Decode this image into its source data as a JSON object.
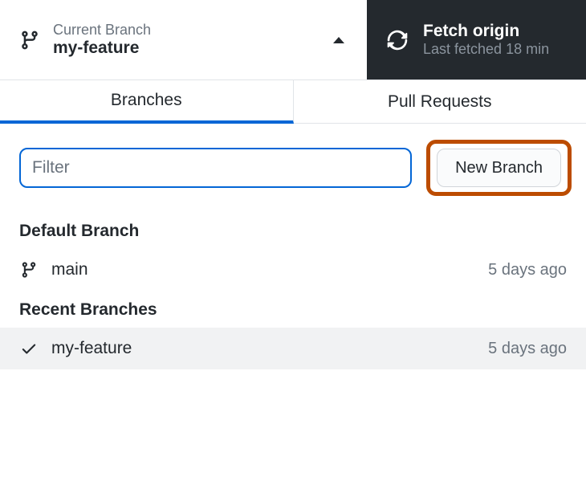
{
  "toolbar": {
    "branchLabel": "Current Branch",
    "branchValue": "my-feature",
    "fetchLabel": "Fetch origin",
    "fetchValue": "Last fetched 18 min"
  },
  "tabs": {
    "branches": "Branches",
    "pullRequests": "Pull Requests"
  },
  "controls": {
    "filterPlaceholder": "Filter",
    "newBranchLabel": "New Branch"
  },
  "sections": {
    "defaultBranch": "Default Branch",
    "recentBranches": "Recent Branches"
  },
  "branches": {
    "default": {
      "name": "main",
      "time": "5 days ago"
    },
    "recent": {
      "name": "my-feature",
      "time": "5 days ago"
    }
  }
}
